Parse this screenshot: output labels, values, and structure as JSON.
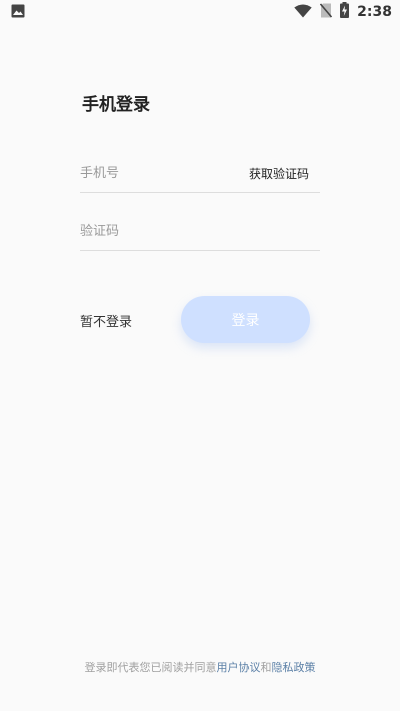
{
  "status_bar": {
    "time": "2:38",
    "icons": [
      "image-icon",
      "wifi-icon",
      "no-sim-icon",
      "battery-charging-icon"
    ]
  },
  "page": {
    "title": "手机登录"
  },
  "form": {
    "phone_placeholder": "手机号",
    "phone_value": "",
    "get_code_label": "获取验证码",
    "code_placeholder": "验证码",
    "code_value": ""
  },
  "actions": {
    "skip_label": "暂不登录",
    "login_label": "登录"
  },
  "agreement": {
    "prefix": "登录即代表您已阅读并同意",
    "user_agreement": "用户协议",
    "conjunction": "和",
    "privacy_policy": "隐私政策"
  },
  "colors": {
    "background": "#fafafa",
    "login_button": "#cfe0ff",
    "link": "#5a7fa6"
  }
}
